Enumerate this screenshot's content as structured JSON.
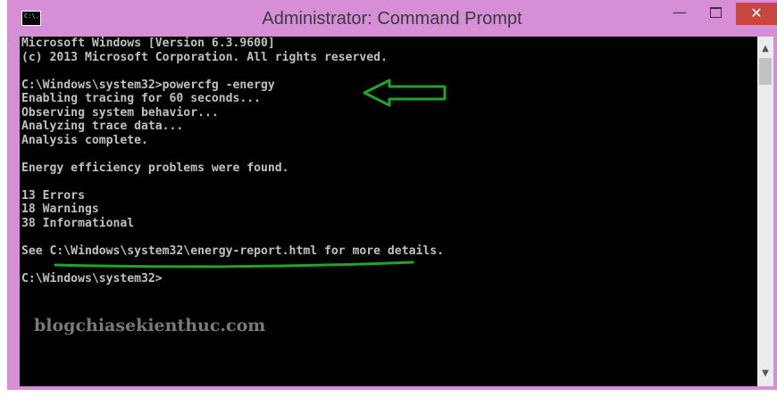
{
  "window": {
    "title": "Administrator: Command Prompt",
    "icon_text": "C:\\.",
    "icon": "cmd-icon",
    "frame_color": "#d68fd6",
    "controls": {
      "minimize": "—",
      "close": "✕"
    }
  },
  "console": {
    "lines": [
      "Microsoft Windows [Version 6.3.9600]",
      "(c) 2013 Microsoft Corporation. All rights reserved.",
      "",
      "C:\\Windows\\system32>powercfg -energy",
      "Enabling tracing for 60 seconds...",
      "Observing system behavior...",
      "Analyzing trace data...",
      "Analysis complete.",
      "",
      "Energy efficiency problems were found.",
      "",
      "13 Errors",
      "18 Warnings",
      "38 Informational",
      "",
      "See C:\\Windows\\system32\\energy-report.html for more details.",
      "",
      "C:\\Windows\\system32>"
    ]
  },
  "watermark": "blogchiasekienthuc.com",
  "annotations": {
    "color": "#1fa32a"
  }
}
